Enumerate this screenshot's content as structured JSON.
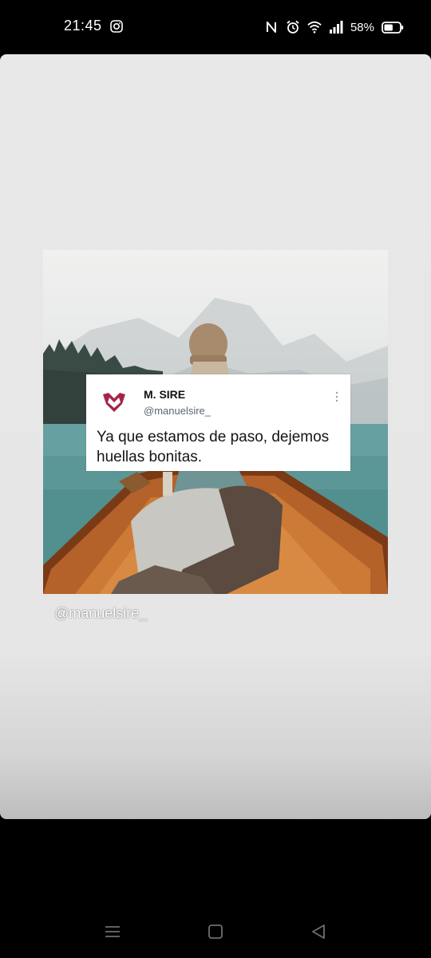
{
  "status_bar": {
    "time": "21:45",
    "battery_percent": "58%",
    "battery_level": 0.58,
    "icons": [
      "instagram-icon",
      "nfc-icon",
      "alarm-icon",
      "wifi-icon",
      "signal-icon",
      "battery-icon"
    ]
  },
  "story": {
    "tweet": {
      "name": "M. SIRE",
      "handle": "@manuelsire_",
      "text": "Ya que estamos de paso, dejemos huellas bonitas.",
      "avatar_color": "#a5244a"
    },
    "mention": "@manuelsire_",
    "background_color": "#e8e8e8"
  },
  "nav_bar": {
    "buttons": [
      "menu-icon",
      "home-icon",
      "back-icon"
    ]
  }
}
